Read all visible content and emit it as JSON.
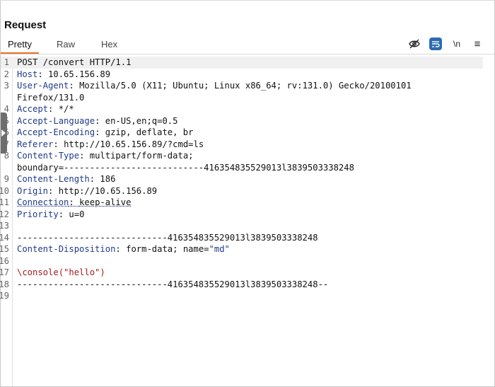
{
  "panel": {
    "title": "Request"
  },
  "tabs": [
    {
      "label": "Pretty"
    },
    {
      "label": "Raw"
    },
    {
      "label": "Hex"
    }
  ],
  "toolbar": {
    "icons": [
      "eye-slash-icon",
      "wrap-text-icon",
      "newline-icon",
      "menu-icon"
    ],
    "newline_label": "\\n",
    "menu_label": "≡"
  },
  "request": {
    "lines": [
      {
        "num": "1",
        "text": "POST /convert HTTP/1.1"
      },
      {
        "num": "2",
        "key": "Host",
        "value": "10.65.156.89"
      },
      {
        "num": "3",
        "key": "User-Agent",
        "value": "Mozilla/5.0 (X11; Ubuntu; Linux x86_64; rv:131.0) Gecko/20100101"
      },
      {
        "num": "",
        "text": "Firefox/131.0"
      },
      {
        "num": "4",
        "key": "Accept",
        "value": "*/*"
      },
      {
        "num": "5",
        "key": "Accept-Language",
        "value": "en-US,en;q=0.5"
      },
      {
        "num": "6",
        "key": "Accept-Encoding",
        "value": "gzip, deflate, br"
      },
      {
        "num": "7",
        "key": "Referer",
        "value": "http://10.65.156.89/?cmd=ls"
      },
      {
        "num": "8",
        "key": "Content-Type",
        "value": "multipart/form-data;"
      },
      {
        "num": "",
        "text": "boundary=---------------------------416354835529013l3839503338248"
      },
      {
        "num": "9",
        "key": "Content-Length",
        "value": "186"
      },
      {
        "num": "10",
        "key": "Origin",
        "value": "http://10.65.156.89"
      },
      {
        "num": "11",
        "key": "Connection",
        "value": "keep-alive"
      },
      {
        "num": "12",
        "key": "Priority",
        "value": "u=0"
      },
      {
        "num": "13",
        "text": ""
      },
      {
        "num": "14",
        "text": "-----------------------------416354835529013l3839503338248"
      },
      {
        "num": "15",
        "key": "Content-Disposition",
        "value": "form-data; name=",
        "quoted": "\"md\""
      },
      {
        "num": "16",
        "text": ""
      },
      {
        "num": "17",
        "text": "\\console(\"hello\")"
      },
      {
        "num": "18",
        "text": "-----------------------------416354835529013l3839503338248--"
      },
      {
        "num": "19",
        "text": ""
      }
    ]
  }
}
